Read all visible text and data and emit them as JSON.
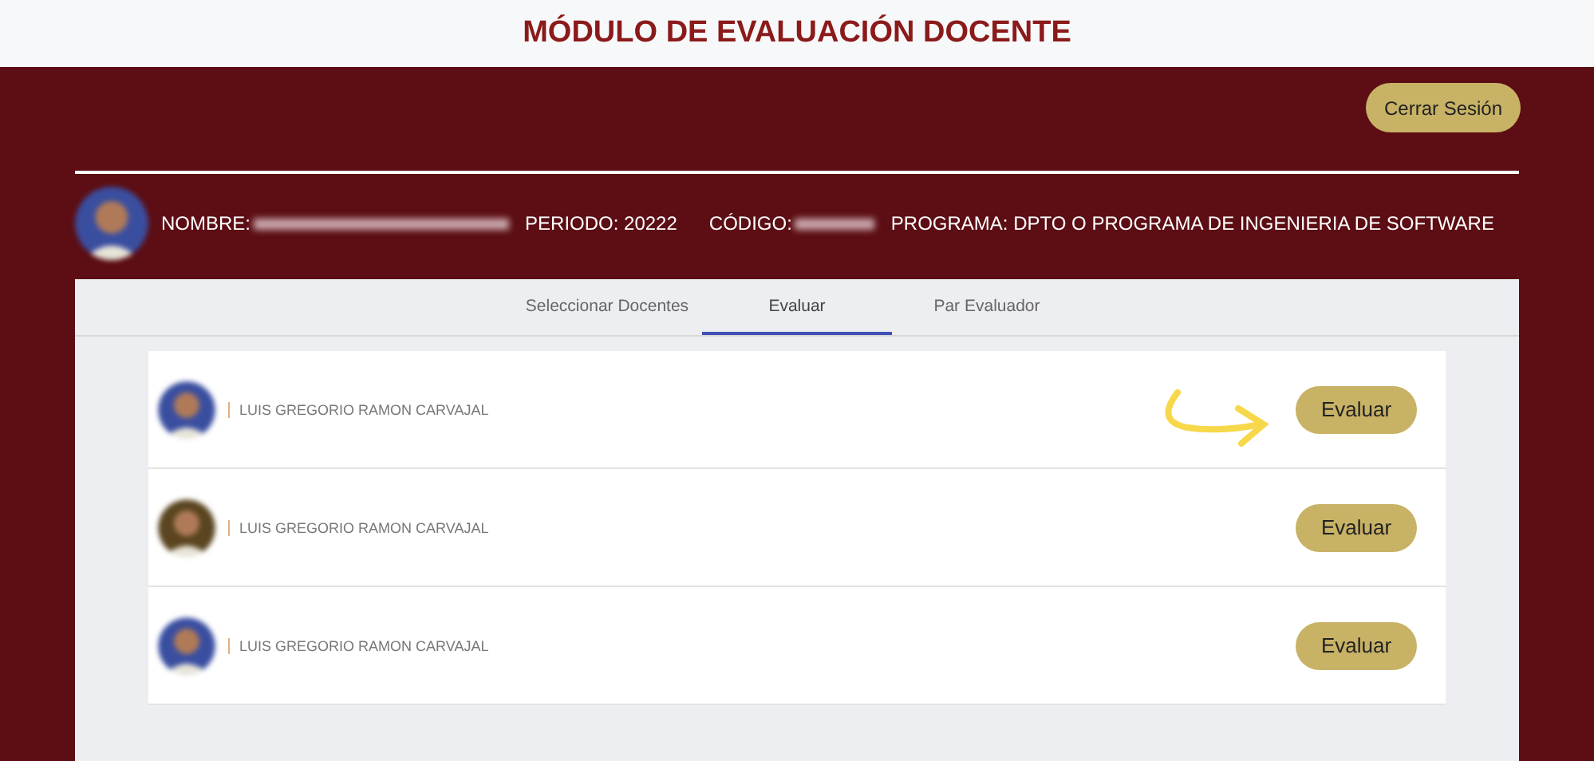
{
  "header": {
    "title": "MÓDULO DE EVALUACIÓN DOCENTE"
  },
  "logout_button": "Cerrar Sesión",
  "user_info": {
    "nombre_label": "NOMBRE:",
    "periodo": "PERIODO: 20222",
    "codigo_label": "CÓDIGO:",
    "programa": "PROGRAMA: DPTO O PROGRAMA DE INGENIERIA DE SOFTWARE"
  },
  "tabs": [
    {
      "label": "Seleccionar Docentes",
      "selected": false
    },
    {
      "label": "Evaluar",
      "selected": true
    },
    {
      "label": "Par Evaluador",
      "selected": false
    }
  ],
  "teachers": [
    {
      "name": "LUIS GREGORIO RAMON CARVAJAL",
      "button": "Evaluar",
      "highlighted": true
    },
    {
      "name": "LUIS GREGORIO RAMON CARVAJAL",
      "button": "Evaluar",
      "highlighted": false
    },
    {
      "name": "LUIS GREGORIO RAMON CARVAJAL",
      "button": "Evaluar",
      "highlighted": false
    }
  ]
}
